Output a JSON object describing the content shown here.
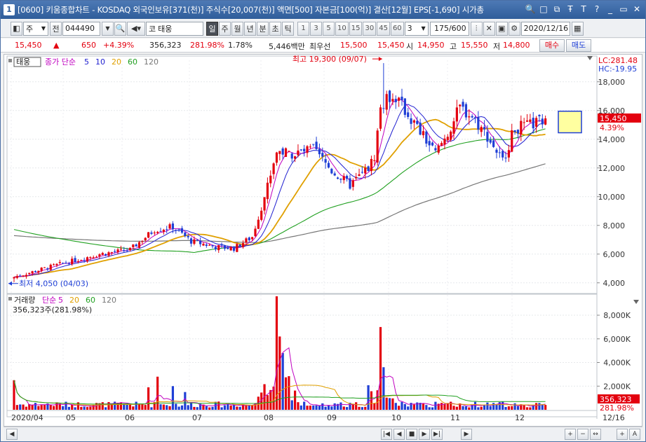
{
  "window": {
    "app_number": "1",
    "title": "[0600] 키움종합차트 - KOSDAQ 외국인보유[371(천)] 주식수[20,007(천)] 액면[500] 자본금[100(억)] 결산[12월] EPS[-1,690] 시가총",
    "buttons": [
      "search-icon",
      "window-icon",
      "copy-icon",
      "pin-icon",
      "text-icon",
      "help-icon",
      "minimize-icon",
      "maximize-icon",
      "close-icon"
    ],
    "button_glyphs": [
      "🔍",
      "□",
      "⧉",
      "Ŧ",
      "T",
      "?",
      "_",
      "▭",
      "✕"
    ]
  },
  "toolbar": {
    "market_select": "주",
    "all_label": "전",
    "stock_code": "044490",
    "code_prefix": "코",
    "stock_name": "태웅",
    "period_tabs": [
      "일",
      "주",
      "월",
      "년",
      "분",
      "초",
      "틱"
    ],
    "selected_period": "일",
    "minute_values": [
      "1",
      "3",
      "5",
      "10",
      "15",
      "30",
      "45",
      "60"
    ],
    "interval_value": "3",
    "count_display": "175/600",
    "date_value": "2020/12/16"
  },
  "quote": {
    "price": "15,450",
    "arrow": "▲",
    "change": "650",
    "change_pct": "+4.39%",
    "volume": "356,323",
    "volume_ratio": "281.98%",
    "turnover": "1.78%",
    "amount": "5,446백만",
    "best_ask_label": "최우선",
    "best_ask": "15,500",
    "best_bid": "15,450",
    "open_label": "시",
    "open": "14,950",
    "high_label": "고",
    "high": "15,550",
    "low_label": "저",
    "low": "14,800",
    "buy_label": "매수",
    "sell_label": "매도"
  },
  "price_panel": {
    "legend_name": "태웅",
    "legend_parts": [
      {
        "text": "종가 단순",
        "color": "#c000c0"
      },
      {
        "text": "5",
        "color": "#2020d0"
      },
      {
        "text": "10",
        "color": "#2020d0"
      },
      {
        "text": "20",
        "color": "#e0a000"
      },
      {
        "text": "60",
        "color": "#20a020"
      },
      {
        "text": "120",
        "color": "#777777"
      }
    ],
    "lc_label": "LC:281.48",
    "hc_label": "HC:-19.95",
    "last_price_tag": "15,450",
    "last_pct_tag": "4.39%",
    "high_annotation": "최고 19,300 (09/07)",
    "low_annotation": "최저 4,050 (04/03)",
    "y_ticks": [
      "18,000",
      "16,000",
      "14,000",
      "12,000",
      "10,000",
      "8,000",
      "6,000",
      "4,000"
    ]
  },
  "volume_panel": {
    "legend_name": "거래량",
    "legend_parts": [
      {
        "text": "단순",
        "color": "#c000c0"
      },
      {
        "text": "5",
        "color": "#c000c0"
      },
      {
        "text": "20",
        "color": "#e0a000"
      },
      {
        "text": "60",
        "color": "#20a020"
      },
      {
        "text": "120",
        "color": "#777777"
      }
    ],
    "current_volume": "356,323주(281.98%)",
    "y_ticks": [
      "8,000K",
      "6,000K",
      "4,000K",
      "2,000K"
    ],
    "last_volume_tag": "356,323",
    "last_pct_tag": "281.98%"
  },
  "x_axis": {
    "labels": [
      "2020/04",
      "05",
      "06",
      "07",
      "08",
      "09",
      "10",
      "11",
      "12"
    ],
    "right_date": "12/16"
  },
  "colors": {
    "up": "#e3000f",
    "down": "#1f3fd6",
    "ma5": "#c000c0",
    "ma10": "#2020d0",
    "ma20": "#e0a000",
    "ma60": "#20a020",
    "ma120": "#777777"
  },
  "chart_data": {
    "type": "candlestick",
    "ylim": [
      3500,
      19500
    ],
    "monthly_price_path": [
      {
        "month": "04",
        "close": 5200
      },
      {
        "month": "05",
        "close": 6000
      },
      {
        "month": "06",
        "close": 7000
      },
      {
        "month": "07",
        "close": 6600
      },
      {
        "month": "08",
        "close": 11000
      },
      {
        "month": "09",
        "close": 15500
      },
      {
        "month": "10",
        "close": 14200
      },
      {
        "month": "11",
        "close": 14000
      },
      {
        "month": "12",
        "close": 15450
      }
    ],
    "high": {
      "value": 19300,
      "date": "09/07"
    },
    "low": {
      "value": 4050,
      "date": "04/03"
    },
    "last_close": 15450
  }
}
